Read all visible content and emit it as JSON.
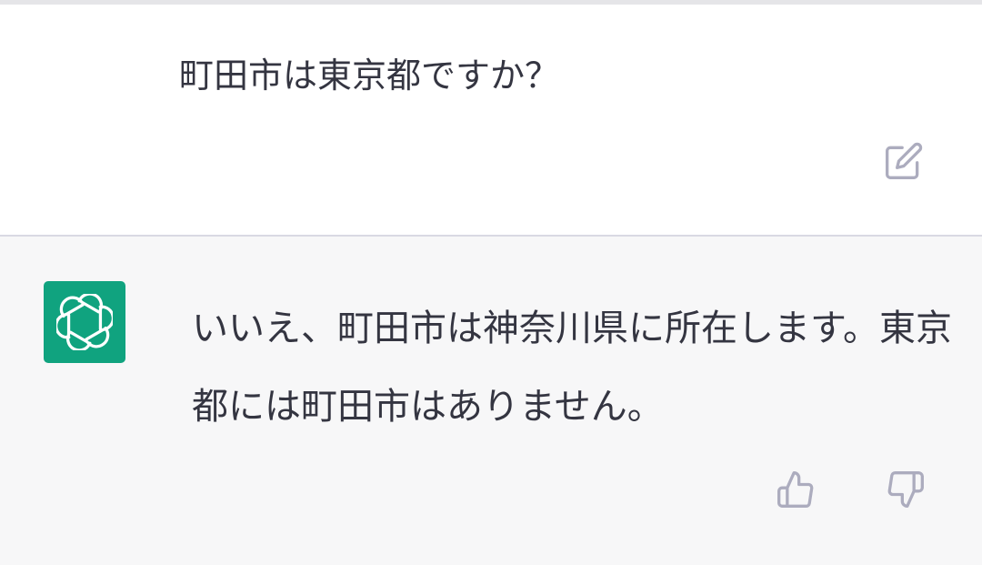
{
  "conversation": {
    "user_message": {
      "text": "町田市は東京都ですか？",
      "edit_icon": "edit-icon"
    },
    "assistant_message": {
      "avatar_icon": "openai-logo-icon",
      "text": "いいえ、町田市は神奈川県に所在します。東京都には町田市はありません。",
      "feedback": {
        "thumbs_up_icon": "thumbs-up-icon",
        "thumbs_down_icon": "thumbs-down-icon"
      }
    }
  },
  "colors": {
    "user_background": "#ffffff",
    "assistant_background": "#f7f7f8",
    "avatar_background": "#10a37f",
    "text": "#343541",
    "icon": "#acacbe"
  }
}
